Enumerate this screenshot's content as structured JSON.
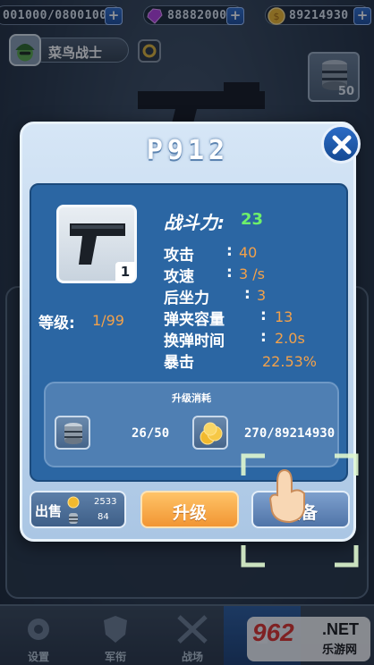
{
  "top_bar": {
    "gold_top": "001000/08001000",
    "gems": "88882000",
    "coins": "89214930",
    "plus": "+"
  },
  "player": {
    "name": "菜鸟战士"
  },
  "ammo_box": {
    "count": "50"
  },
  "weapon": {
    "name": "P912",
    "thumb_level": "1",
    "power_label": "战斗力:",
    "power_value": "23",
    "level_label": "等级:",
    "level_value": "1/99",
    "stats": [
      {
        "label": "攻击",
        "colon": ":",
        "value": "40"
      },
      {
        "label": "攻速",
        "colon": ":",
        "value": "3 /s"
      },
      {
        "label": "后坐力",
        "colon": ":",
        "value": "3"
      },
      {
        "label": "弹夹容量",
        "colon": ":",
        "value": "13"
      },
      {
        "label": "换弹时间",
        "colon": ":",
        "value": "2.0s"
      },
      {
        "label": "暴击",
        "colon": "",
        "value": "22.53%"
      }
    ]
  },
  "upgrade_cost": {
    "title": "升级消耗",
    "ammo_cost": "26/50",
    "coin_cost": "270/89214930"
  },
  "buttons": {
    "sell": "出售",
    "sell_coin": "2533",
    "sell_ammo": "84",
    "upgrade": "升级",
    "equip": "装备"
  },
  "bottom_nav": [
    {
      "label": "设置"
    },
    {
      "label": "军衔"
    },
    {
      "label": "战场"
    }
  ],
  "watermark": {
    "big": "962",
    "net": ".NET",
    "cn": "乐游网"
  },
  "colors": {
    "power": "#6ef06a",
    "stat_value": "#f3a14a",
    "upgrade_button": "#f19533",
    "panel_blue": "#2b66a3"
  }
}
